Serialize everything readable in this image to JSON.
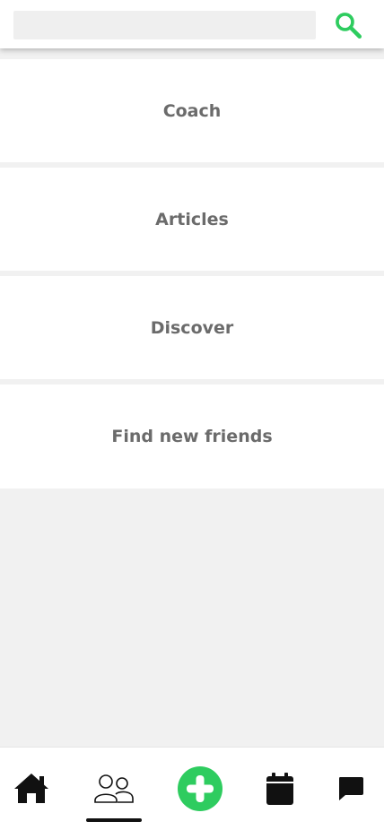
{
  "colors": {
    "accent": "#2ecc5f",
    "background": "#f1f1f1",
    "card": "#ffffff",
    "label": "#6b6b6b",
    "icon": "#111111"
  },
  "search": {
    "value": "",
    "placeholder": "",
    "icon": "search-icon"
  },
  "menu": {
    "items": [
      {
        "label": "Coach"
      },
      {
        "label": "Articles"
      },
      {
        "label": "Discover"
      },
      {
        "label": "Find new friends"
      }
    ]
  },
  "bottom_nav": {
    "active": "community",
    "items": [
      {
        "id": "home",
        "icon": "home-icon"
      },
      {
        "id": "community",
        "icon": "people-icon"
      },
      {
        "id": "add",
        "icon": "add-circle-icon"
      },
      {
        "id": "calendar",
        "icon": "calendar-icon"
      },
      {
        "id": "messages",
        "icon": "chat-icon"
      }
    ]
  }
}
